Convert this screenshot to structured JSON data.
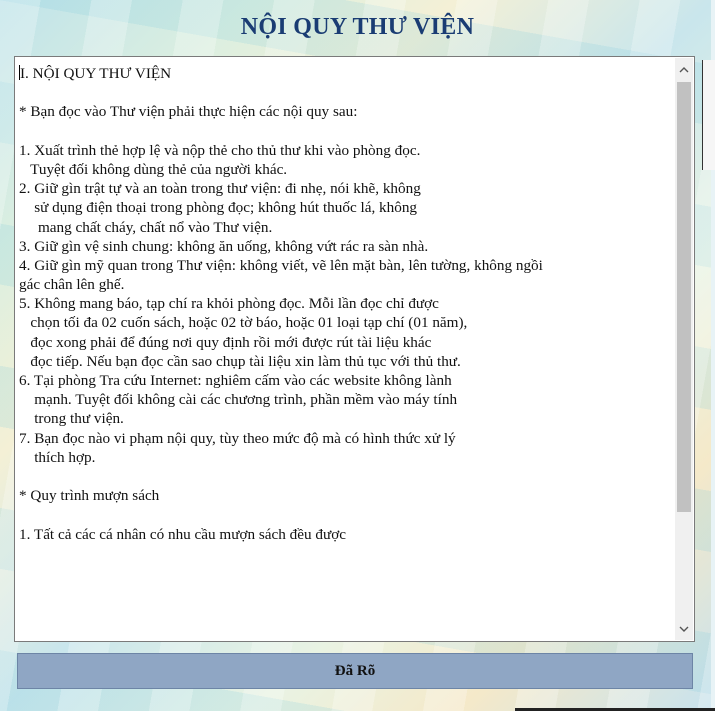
{
  "dialog": {
    "title": "NỘI QUY THƯ VIỆN",
    "lines": [
      "I. NỘI QUY THƯ VIỆN",
      "",
      "* Bạn đọc vào Thư viện phải thực hiện các nội quy sau:",
      "",
      "1. Xuất trình thẻ hợp lệ và nộp thẻ cho thủ thư khi vào phòng đọc.",
      "   Tuyệt đối không dùng thẻ của người khác.",
      "2. Giữ gìn trật tự và an toàn trong thư viện: đi nhẹ, nói khẽ, không",
      "    sử dụng điện thoại trong phòng đọc; không hút thuốc lá, không",
      "     mang chất cháy, chất nổ vào Thư viện.",
      "3. Giữ gìn vệ sinh chung: không ăn uống, không vứt rác ra sàn nhà.",
      "4. Giữ gìn mỹ quan trong Thư viện: không viết, vẽ lên mặt bàn, lên tường, không ngồi",
      "gác chân lên ghế.",
      "5. Không mang báo, tạp chí ra khỏi phòng đọc. Mỗi lần đọc chỉ được",
      "   chọn tối đa 02 cuốn sách, hoặc 02 tờ báo, hoặc 01 loại tạp chí (01 năm),",
      "   đọc xong phải để đúng nơi quy định rồi mới được rút tài liệu khác",
      "   đọc tiếp. Nếu bạn đọc cần sao chụp tài liệu xin làm thủ tục với thủ thư.",
      "6. Tại phòng Tra cứu Internet: nghiêm cấm vào các website không lành",
      "    mạnh. Tuyệt đối không cài các chương trình, phần mềm vào máy tính",
      "    trong thư viện.",
      "7. Bạn đọc nào vi phạm nội quy, tùy theo mức độ mà có hình thức xử lý",
      "    thích hợp.",
      "",
      "* Quy trình mượn sách",
      "",
      "1. Tất cả các cá nhân có nhu cầu mượn sách đều được"
    ],
    "button_label": "Đã Rõ",
    "scroll_up_icon": "chevron-up-icon",
    "scroll_down_icon": "chevron-down-icon"
  }
}
